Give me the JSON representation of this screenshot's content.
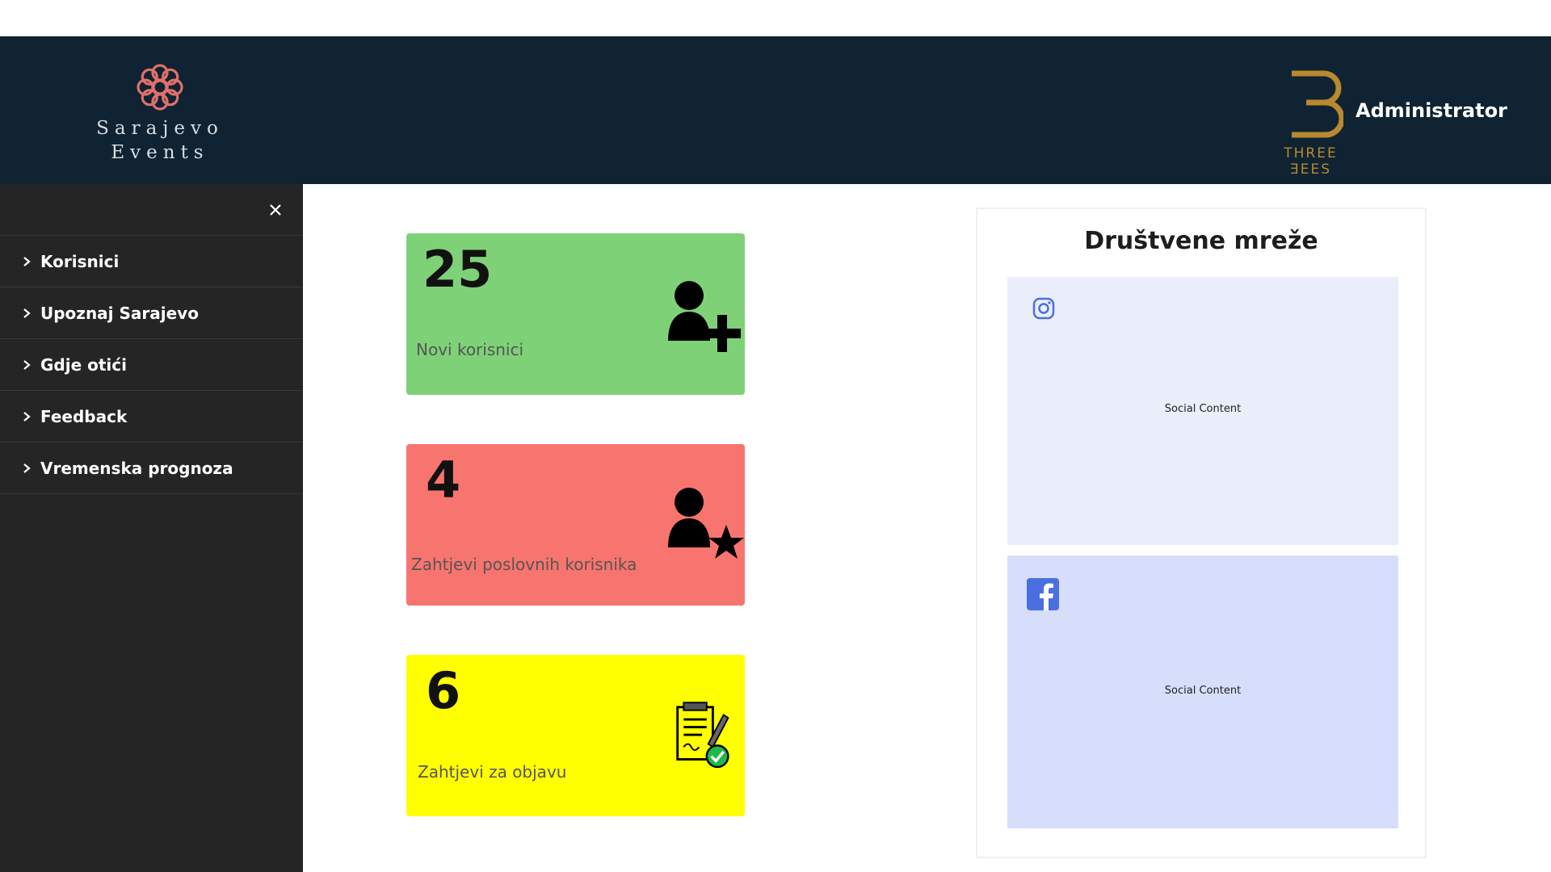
{
  "header": {
    "logo_line1": "Sarajevo",
    "logo_line2": "Events",
    "brand_text": "THREE ƎEES",
    "user_label": "Administrator",
    "colors": {
      "header_bg": "#0f2332",
      "logo_accent": "#e0706a",
      "brand_gold": "#b8892e"
    }
  },
  "sidebar": {
    "close_icon": "close-icon",
    "items": [
      {
        "label": "Korisnici"
      },
      {
        "label": "Upoznaj Sarajevo"
      },
      {
        "label": "Gdje otići"
      },
      {
        "label": "Feedback"
      },
      {
        "label": "Vremenska prognoza"
      }
    ]
  },
  "cards": [
    {
      "value": "25",
      "label": "Novi korisnici",
      "icon": "add-user-icon",
      "color": "#7ed177"
    },
    {
      "value": "4",
      "label": "Zahtjevi poslovnih korisnika",
      "icon": "business-user-star-icon",
      "color": "#f8746e"
    },
    {
      "value": "6",
      "label": "Zahtjevi za objavu",
      "icon": "approved-document-icon",
      "color": "#ffff00"
    }
  ],
  "social": {
    "title": "Društvene mreže",
    "boxes": [
      {
        "icon": "instagram-icon",
        "content": "Social Content",
        "color": "#eaeefb"
      },
      {
        "icon": "facebook-icon",
        "content": "Social Content",
        "color": "#d6defb"
      }
    ]
  }
}
